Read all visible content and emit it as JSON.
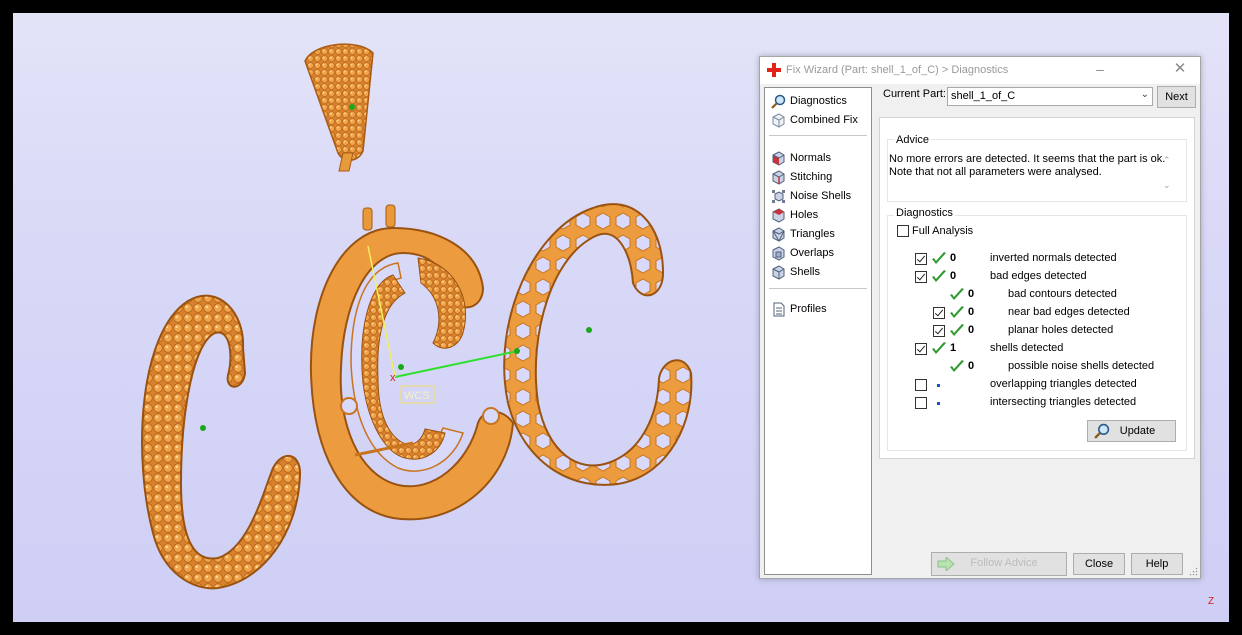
{
  "window": {
    "title": "Fix Wizard (Part: shell_1_of_C) > Diagnostics"
  },
  "viewport": {
    "wcs_label": "WCS",
    "axis_z_label": "Z"
  },
  "nav": {
    "items": [
      {
        "label": "Diagnostics",
        "icon": "magnifier-icon"
      },
      {
        "label": "Combined Fix",
        "icon": "cube-outline-icon"
      },
      {
        "label": "Normals",
        "icon": "normals-cube-icon"
      },
      {
        "label": "Stitching",
        "icon": "stitching-cube-icon"
      },
      {
        "label": "Noise Shells",
        "icon": "noise-shells-icon"
      },
      {
        "label": "Holes",
        "icon": "holes-cube-icon"
      },
      {
        "label": "Triangles",
        "icon": "triangles-cube-icon"
      },
      {
        "label": "Overlaps",
        "icon": "overlaps-cube-icon"
      },
      {
        "label": "Shells",
        "icon": "shells-cube-icon"
      },
      {
        "label": "Profiles",
        "icon": "document-icon"
      }
    ]
  },
  "current_part": {
    "label": "Current Part:",
    "value": "shell_1_of_C",
    "next_label": "Next"
  },
  "advice": {
    "heading": "Advice",
    "line1": "No more errors are detected. It seems that the part is ok.",
    "line2": "Note that not all parameters were analysed."
  },
  "diagnostics": {
    "heading": "Diagnostics",
    "full_analysis_label": "Full Analysis",
    "full_analysis_checked": false,
    "rows": [
      {
        "label": "inverted normals detected",
        "count": "0",
        "checked": true,
        "status": "ok",
        "indent": 0
      },
      {
        "label": "bad edges detected",
        "count": "0",
        "checked": true,
        "status": "ok",
        "indent": 0
      },
      {
        "label": "bad contours detected",
        "count": "0",
        "checked": null,
        "status": "ok",
        "indent": 1
      },
      {
        "label": "near bad edges detected",
        "count": "0",
        "checked": true,
        "status": "ok",
        "indent": 1
      },
      {
        "label": "planar holes detected",
        "count": "0",
        "checked": true,
        "status": "ok",
        "indent": 1
      },
      {
        "label": "shells detected",
        "count": "1",
        "checked": true,
        "status": "ok",
        "indent": 0
      },
      {
        "label": "possible noise shells detected",
        "count": "0",
        "checked": null,
        "status": "ok",
        "indent": 1
      },
      {
        "label": "overlapping triangles detected",
        "count": "",
        "checked": false,
        "status": "pending",
        "indent": 0
      },
      {
        "label": "intersecting triangles detected",
        "count": "",
        "checked": false,
        "status": "pending",
        "indent": 0
      }
    ],
    "update_label": "Update"
  },
  "footer": {
    "follow_advice_label": "Follow Advice",
    "close_label": "Close",
    "help_label": "Help"
  },
  "colors": {
    "model_gold": "#e8993a",
    "check_green": "#2f9a2f",
    "pending_blue": "#1b4fd1",
    "title_cross_red": "#e2231a"
  }
}
